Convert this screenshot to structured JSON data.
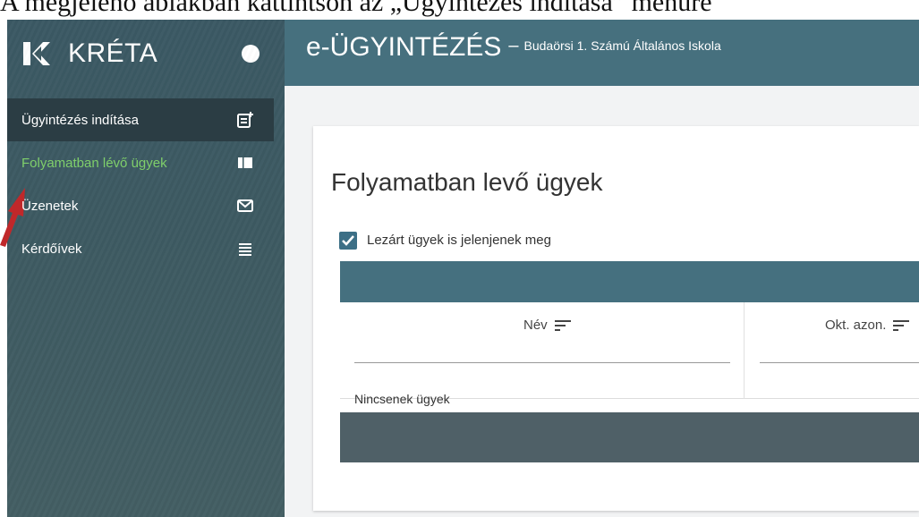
{
  "caption": "A megjelenő ablakban kattintson az „Ügyintézés indítása” menüre",
  "app": {
    "brand": "KRÉTA"
  },
  "topbar": {
    "title": "e-ÜGYINTÉZÉS",
    "separator": "–",
    "school": "Budaörsi 1. Számú Általános Iskola"
  },
  "sidebar": {
    "items": [
      {
        "label": "Ügyintézés indítása",
        "icon": "new-document-icon"
      },
      {
        "label": "Folyamatban lévő ügyek",
        "icon": "panel-icon"
      },
      {
        "label": "Üzenetek",
        "icon": "mail-icon"
      },
      {
        "label": "Kérdőívek",
        "icon": "list-icon"
      }
    ]
  },
  "main": {
    "title": "Folyamatban levő ügyek",
    "closed_checkbox": {
      "label": "Lezárt ügyek is jelenjenek meg",
      "checked": true
    },
    "columns": [
      {
        "label": "Név",
        "icon": "sort-icon"
      },
      {
        "label": "Okt. azon.",
        "icon": "sort-icon"
      }
    ],
    "empty_text": "Nincsenek ügyek"
  },
  "colors": {
    "sidebar": "#3d5a62",
    "topbar": "#46707e",
    "active_item": "#2b3d44",
    "current_item_text": "#7fcf6b",
    "arrow": "#c0282a"
  }
}
